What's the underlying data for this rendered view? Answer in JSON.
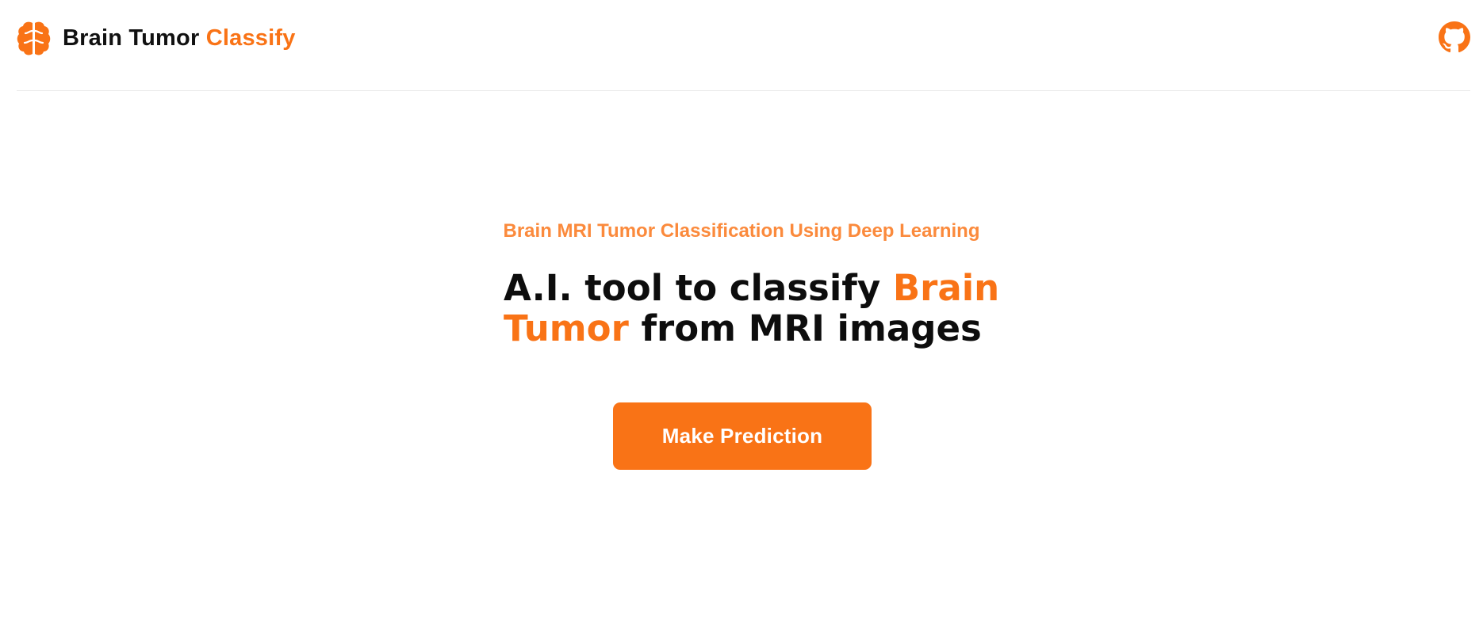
{
  "colors": {
    "accent": "#f97316",
    "kicker": "#fb8a3c",
    "text": "#0d0d0d",
    "background": "#ffffff",
    "divider": "#e8e8e8"
  },
  "navbar": {
    "logo_icon": "brain-icon",
    "brand_main": "Brain Tumor",
    "brand_accent": "Classify",
    "github_icon": "github-icon"
  },
  "hero": {
    "kicker": "Brain MRI Tumor Classification Using Deep Learning",
    "headline": {
      "part1": "A.I. tool to classify",
      "accent1": "Brain",
      "accent2": "Tumor",
      "part2": "from MRI images"
    },
    "cta_label": "Make Prediction"
  }
}
